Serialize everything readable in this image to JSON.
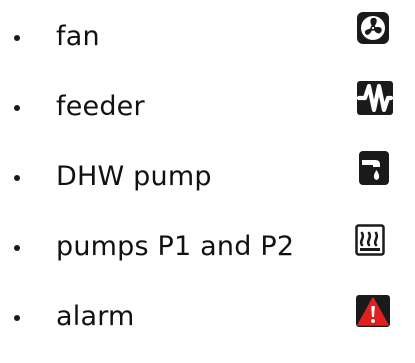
{
  "colors": {
    "text": "#111111",
    "icon_dark": "#1a1a1a",
    "icon_light": "#ffffff",
    "alarm_red": "#e02020"
  },
  "items": [
    {
      "label": "fan",
      "icon": "fan-icon"
    },
    {
      "label": "feeder",
      "icon": "feeder-icon"
    },
    {
      "label": "DHW pump",
      "icon": "dhw-pump-icon"
    },
    {
      "label": "pumps P1 and P2",
      "icon": "heating-pumps-icon"
    },
    {
      "label": "alarm",
      "icon": "alarm-icon"
    }
  ]
}
